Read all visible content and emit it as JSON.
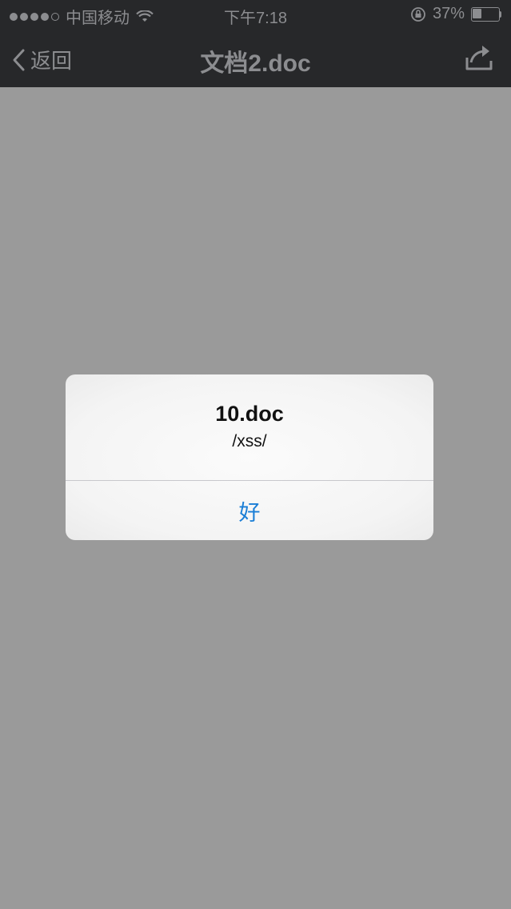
{
  "status_bar": {
    "carrier": "中国移动",
    "time": "下午7:18",
    "battery_percent": "37%",
    "battery_level": 0.37,
    "signal_dots_filled": 4,
    "signal_dots_total": 5
  },
  "nav_bar": {
    "back_label": "返回",
    "title": "文档2.doc",
    "share_icon": "share-icon"
  },
  "alert": {
    "title": "10.doc",
    "message": "/xss/",
    "button_label": "好"
  },
  "colors": {
    "overlay": "#9a9a9a",
    "navbar": "#27282a",
    "alert_button": "#1a7ed6"
  }
}
